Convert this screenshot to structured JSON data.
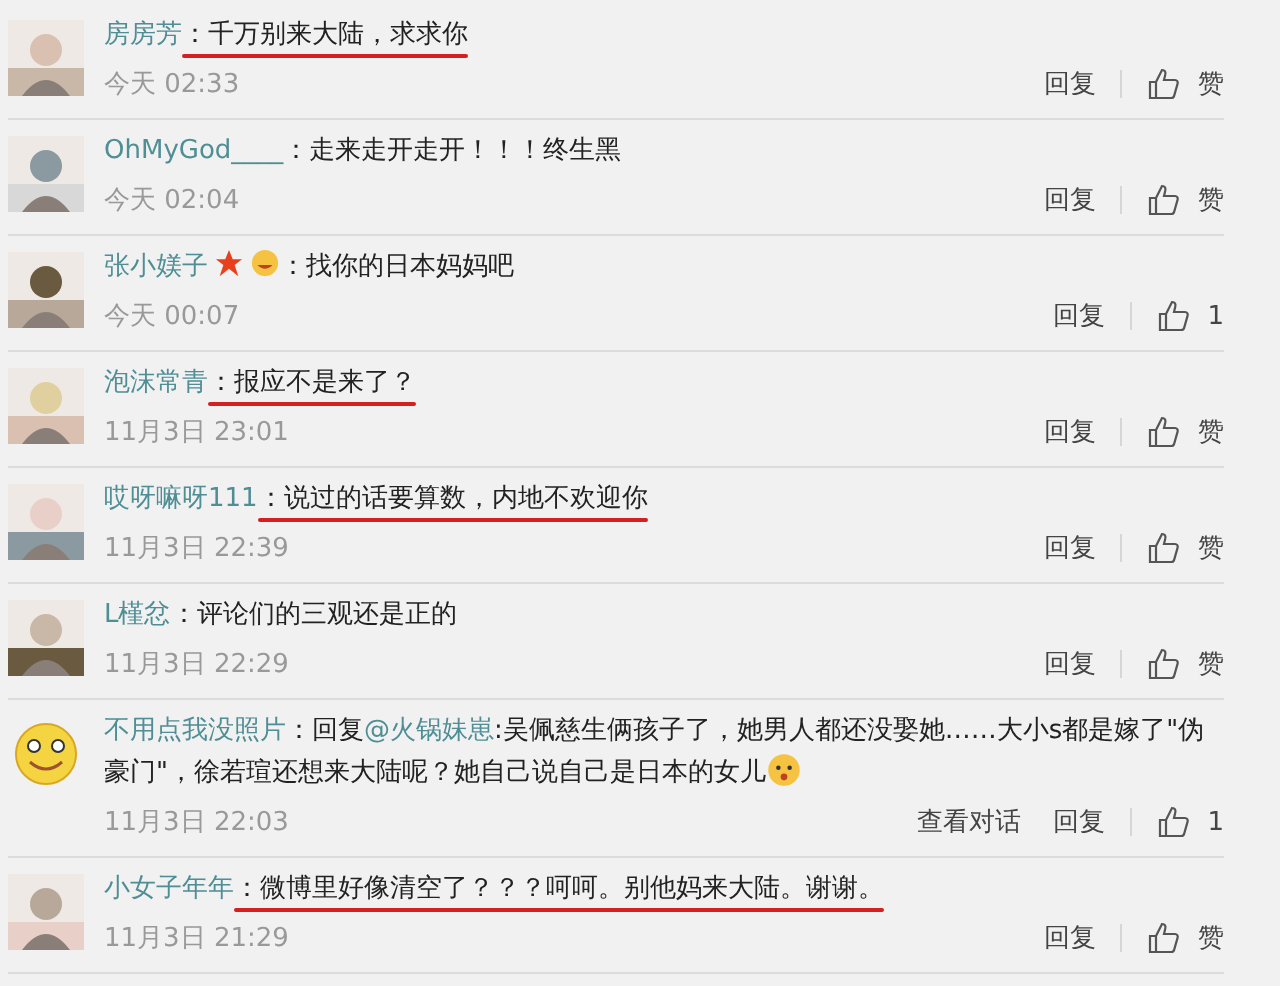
{
  "comments": [
    {
      "avatar": {
        "kind": "picture"
      },
      "name": "房房芳",
      "body": [
        {
          "kind": "text",
          "text": "：千万别来大陆，求求你"
        }
      ],
      "underlined": true,
      "time": "今天 02:33",
      "actions": [
        "回复"
      ],
      "like": "赞"
    },
    {
      "avatar": {
        "kind": "picture"
      },
      "name": "OhMyGod____",
      "body": [
        {
          "kind": "text",
          "text": "：走来走开走开！！！终生黑"
        }
      ],
      "underlined": false,
      "time": "今天 02:04",
      "actions": [
        "回复"
      ],
      "like": "赞"
    },
    {
      "avatar": {
        "kind": "picture"
      },
      "name": "张小媄子",
      "badges": [
        {
          "kind": "star"
        },
        {
          "kind": "emoji"
        }
      ],
      "body": [
        {
          "kind": "text",
          "text": "：找你的日本妈妈吧"
        }
      ],
      "underlined": false,
      "time": "今天 00:07",
      "actions": [
        "回复"
      ],
      "like": "1"
    },
    {
      "avatar": {
        "kind": "picture"
      },
      "name": "泡沫常青",
      "body": [
        {
          "kind": "text",
          "text": "：报应不是来了？"
        }
      ],
      "underlined": true,
      "time": "11月3日 23:01",
      "actions": [
        "回复"
      ],
      "like": "赞"
    },
    {
      "avatar": {
        "kind": "picture"
      },
      "name": "哎呀嘛呀111",
      "body": [
        {
          "kind": "text",
          "text": "：说过的话要算数，内地不欢迎你"
        }
      ],
      "underlined": true,
      "time": "11月3日 22:39",
      "actions": [
        "回复"
      ],
      "like": "赞"
    },
    {
      "avatar": {
        "kind": "picture"
      },
      "name": "L槿忿",
      "body": [
        {
          "kind": "text",
          "text": "：评论们的三观还是正的"
        }
      ],
      "underlined": false,
      "time": "11月3日 22:29",
      "actions": [
        "回复"
      ],
      "like": "赞"
    },
    {
      "avatar": {
        "kind": "smiley"
      },
      "name": "不用点我没照片",
      "body": [
        {
          "kind": "text",
          "text": "：回复"
        },
        {
          "kind": "mention",
          "text": "@火锅妹崽"
        },
        {
          "kind": "text",
          "text": ":吴佩慈生俩孩子了，她男人都还没娶她……大小s都是嫁了\"伪豪门\"，徐若瑄还想来大陆呢？她自己说自己是日本的女儿"
        },
        {
          "kind": "emoji"
        }
      ],
      "underlined": false,
      "time": "11月3日 22:03",
      "actions": [
        "查看对话",
        "回复"
      ],
      "like": "1"
    },
    {
      "avatar": {
        "kind": "picture"
      },
      "name": "小女子年年",
      "body": [
        {
          "kind": "text",
          "text": "：微博里好像清空了？？？呵呵。别他妈来大陆。谢谢。"
        }
      ],
      "underlined": true,
      "time": "11月3日 21:29",
      "actions": [
        "回复"
      ],
      "like": "赞"
    }
  ]
}
